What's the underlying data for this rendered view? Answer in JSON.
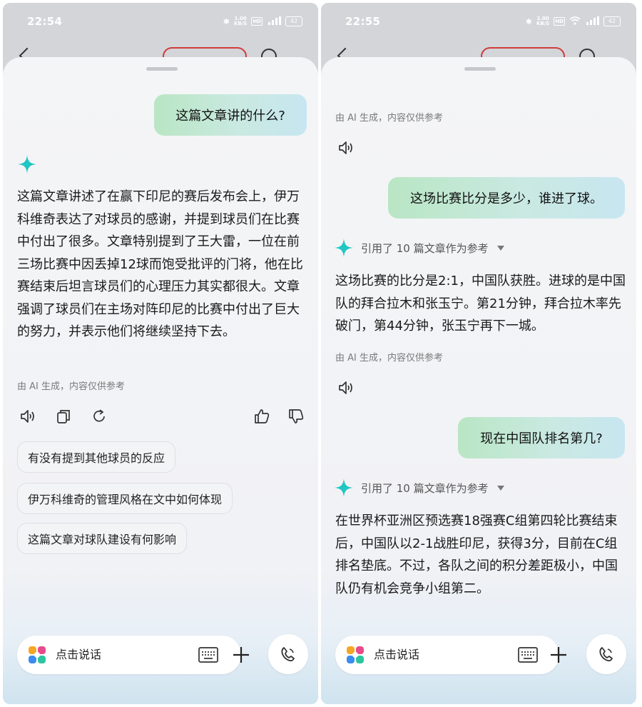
{
  "left_screen": {
    "status_bar": {
      "time": "22:54",
      "net_speed_value": "1.00",
      "net_speed_unit": "KB/S",
      "hd": "HD",
      "signal_label": "5G",
      "battery": "42"
    },
    "user_question": "这篇文章讲的什么?",
    "ai_answer": "这篇文章讲述了在赢下印尼的赛后发布会上，伊万科维奇表达了对球员的感谢，并提到球员们在比赛中付出了很多。文章特别提到了王大雷，一位在前三场比赛中因丢掉12球而饱受批评的门将，他在比赛结束后坦言球员们的心理压力其实都很大。文章强调了球员们在主场对阵印尼的比赛中付出了巨大的努力，并表示他们将继续坚持下去。",
    "disclaimer": "由 AI 生成，内容仅供参考",
    "suggestions": [
      "有没有提到其他球员的反应",
      "伊万科维奇的管理风格在文中如何体现",
      "这篇文章对球队建设有何影响"
    ],
    "input_label": "点击说话"
  },
  "right_screen": {
    "status_bar": {
      "time": "22:55",
      "net_speed_value": "2.00",
      "net_speed_unit": "KB/S",
      "hd": "HD",
      "signal_label": "5G",
      "battery": "42"
    },
    "disclaimer_top": "由 AI 生成，内容仅供参考",
    "messages": [
      {
        "question": "这场比赛比分是多少，谁进了球。",
        "reference": "引用了 10 篇文章作为参考",
        "answer": "这场比赛的比分是2:1，中国队获胜。进球的是中国队的拜合拉木和张玉宁。第21分钟，拜合拉木率先破门，第44分钟，张玉宁再下一城。",
        "disclaimer": "由 AI 生成，内容仅供参考"
      },
      {
        "question": "现在中国队排名第几?",
        "reference": "引用了 10 篇文章作为参考",
        "answer": "在世界杯亚洲区预选赛18强赛C组第四轮比赛结束后，中国队以2-1战胜印尼，获得3分，目前在C组排名垫底。不过，各队之间的积分差距极小，中国队仍有机会竞争小组第二。"
      }
    ],
    "input_label": "点击说话"
  },
  "icons": {
    "sparkle": "sparkle-icon",
    "speaker": "speaker-icon",
    "copy": "copy-icon",
    "refresh": "refresh-icon",
    "like": "thumbs-up-icon",
    "dislike": "thumbs-down-icon",
    "keyboard": "keyboard-icon",
    "plus": "plus-icon",
    "call": "voice-call-icon",
    "app_logo": "app-logo-icon"
  },
  "colors": {
    "accent_teal": "#20c6c2",
    "bubble_green": "#b9e6c4",
    "bubble_blue": "#c8e6f0",
    "text": "#1a1a1a",
    "muted": "#7a7a7a"
  }
}
